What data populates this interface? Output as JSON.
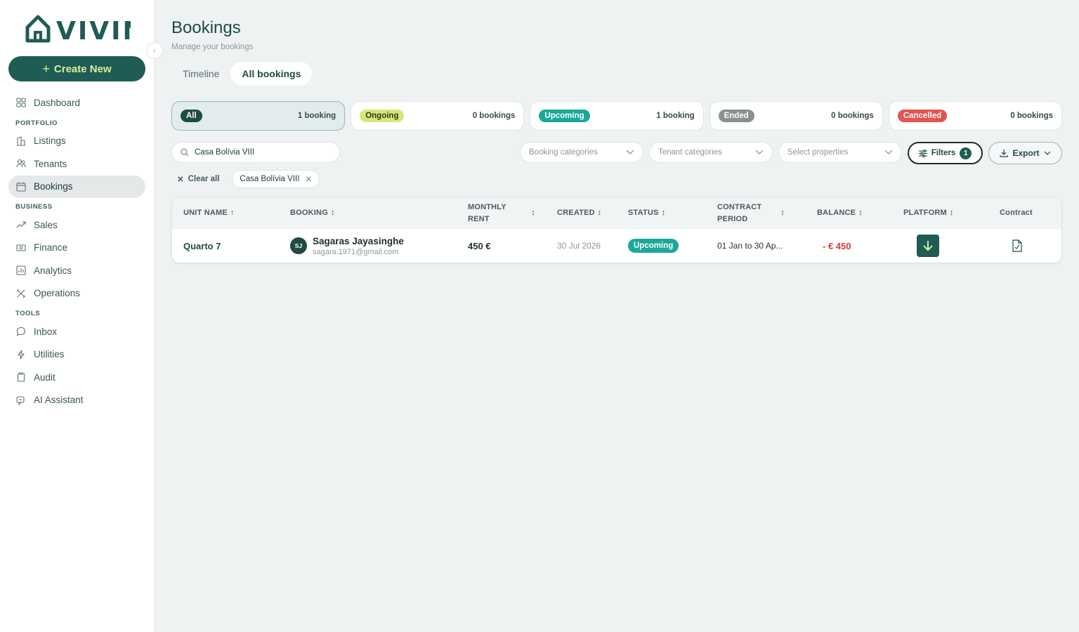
{
  "app": {
    "brand": "VIVIN",
    "create_label": "Create New"
  },
  "nav": {
    "items": [
      {
        "type": "item",
        "label": "Dashboard",
        "icon": "grid-icon"
      },
      {
        "type": "section",
        "label": "PORTFOLIO"
      },
      {
        "type": "item",
        "label": "Listings",
        "icon": "building-icon"
      },
      {
        "type": "item",
        "label": "Tenants",
        "icon": "users-icon"
      },
      {
        "type": "item",
        "label": "Bookings",
        "icon": "calendar-icon",
        "active": true
      },
      {
        "type": "section",
        "label": "BUSINESS"
      },
      {
        "type": "item",
        "label": "Sales",
        "icon": "trend-icon"
      },
      {
        "type": "item",
        "label": "Finance",
        "icon": "cash-icon"
      },
      {
        "type": "item",
        "label": "Analytics",
        "icon": "chart-icon"
      },
      {
        "type": "item",
        "label": "Operations",
        "icon": "tools-icon"
      },
      {
        "type": "section",
        "label": "TOOLS"
      },
      {
        "type": "item",
        "label": "Inbox",
        "icon": "chat-icon"
      },
      {
        "type": "item",
        "label": "Utilities",
        "icon": "bolt-icon"
      },
      {
        "type": "item",
        "label": "Audit",
        "icon": "clipboard-icon"
      },
      {
        "type": "item",
        "label": "AI Assistant",
        "icon": "assistant-icon"
      }
    ]
  },
  "page": {
    "title": "Bookings",
    "subtitle": "Manage your bookings"
  },
  "tabs": [
    {
      "label": "Timeline",
      "active": false
    },
    {
      "label": "All bookings",
      "active": true
    }
  ],
  "status_cards": [
    {
      "label": "All",
      "count": "1 booking",
      "color": "#1f4a45",
      "text_color": "#ffffff",
      "active": true
    },
    {
      "label": "Ongoing",
      "count": "0 bookings",
      "color": "#d6e77a",
      "text_color": "#2d3a1a",
      "active": false
    },
    {
      "label": "Upcoming",
      "count": "1 booking",
      "color": "#1aa89b",
      "text_color": "#ffffff",
      "active": false
    },
    {
      "label": "Ended",
      "count": "0 bookings",
      "color": "#8a8f8f",
      "text_color": "#ffffff",
      "active": false
    },
    {
      "label": "Cancelled",
      "count": "0 bookings",
      "color": "#e5524f",
      "text_color": "#ffffff",
      "active": false
    }
  ],
  "filters": {
    "search_value": "Casa Bolívia VIII",
    "booking_categories": "Booking categories",
    "tenant_categories": "Tenant categories",
    "select_properties": "Select properties",
    "filters_label": "Filters",
    "filters_count": "1",
    "export_label": "Export"
  },
  "chips": {
    "clear_all": "Clear all",
    "active": [
      "Casa Bolívia VIII"
    ]
  },
  "table": {
    "headers": {
      "unit_name": "UNIT NAME",
      "booking": "BOOKING",
      "monthly_rent": "MONTHLY RENT",
      "created": "CREATED",
      "status": "STATUS",
      "contract_period": "CONTRACT PERIOD",
      "balance": "BALANCE",
      "platform": "PLATFORM",
      "contract": "Contract"
    },
    "rows": [
      {
        "unit_name": "Quarto 7",
        "initials": "SJ",
        "guest_name": "Sagaras Jayasinghe",
        "guest_email": "sagara.1971@gmail.com",
        "monthly_rent": "450 €",
        "created": "30 Jul 2026",
        "status": "Upcoming",
        "contract_period": "01 Jan to 30 Ap...",
        "balance": "- € 450",
        "platform_icon": "download-arrow-icon",
        "contract_icon": "document-check-icon"
      }
    ]
  },
  "colors": {
    "brand": "#1f5c55",
    "brand_accent": "#d9f09a",
    "negative": "#d43a34",
    "background": "#eef2f2"
  }
}
